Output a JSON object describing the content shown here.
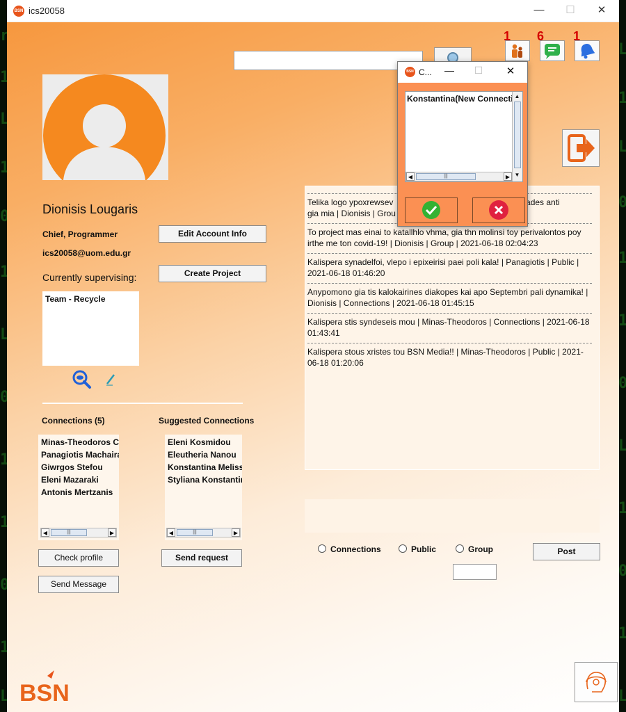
{
  "window": {
    "title": "ics20058",
    "logo_text": "BSN",
    "minimize": "—",
    "maximize": "☐",
    "close": "✕"
  },
  "search": {
    "value": "",
    "button_label": ""
  },
  "notifications": [
    {
      "icon": "connections-icon",
      "count": "1"
    },
    {
      "icon": "chat-icon",
      "count": "6"
    },
    {
      "icon": "bell-icon",
      "count": "1"
    }
  ],
  "profile": {
    "name": "Dionisis Lougaris",
    "role": "Chief, Programmer",
    "email": "ics20058@uom.edu.gr",
    "supervising_label": "Currently supervising:",
    "supervising_items": [
      "Team - Recycle"
    ]
  },
  "buttons": {
    "edit_account": "Edit Account Info",
    "create_project": "Create Project",
    "check_profile": "Check profile",
    "send_request": "Send request",
    "send_message": "Send Message",
    "post": "Post"
  },
  "connections": {
    "label": "Connections (5)",
    "items": [
      "Minas-Theodoros C",
      "Panagiotis Machaira",
      "Giwrgos Stefou",
      "Eleni Mazaraki",
      "Antonis Mertzanis"
    ]
  },
  "suggested": {
    "label": "Suggested Connections",
    "items": [
      "Eleni Kosmidou",
      "Eleutheria Nanou",
      "Konstantina Meliss",
      "Styliana Konstantin"
    ]
  },
  "feed": [
    "Telika logo ypoxrewsewn ... yo bdomades anti gia mia | Dionisis | Grou",
    "To project mas einai to katallhlo vhma, gia thn molinsi toy perivalontos poy irthe me ton covid-19! | Dionisis | Group | 2021-06-18 02:04:23",
    "Kalispera synadelfoi, vlepo i epixeirisi paei poli kala! | Panagiotis | Public | 2021-06-18 01:46:20",
    "Anypomono gia tis kalokairines diakopes kai apo Septembri pali dynamika! | Dionisis | Connections | 2021-06-18 01:45:15",
    "Kalispera stis syndeseis mou | Minas-Theodoros | Connections | 2021-06-18 01:43:41",
    "Kalispera stous xristes tou BSN Media!! | Minas-Theodoros | Public | 2021-06-18 01:20:06"
  ],
  "feed_first_visible": {
    "left": "Telika logo ypoxrewsev",
    "right": "yo bdomades anti",
    "line2": "gia mia | Dionisis | Grou"
  },
  "post_visibility": [
    "Connections",
    "Public",
    "Group"
  ],
  "popup": {
    "title": "C...",
    "items": [
      "Konstantina(New Connectio"
    ]
  },
  "brand_logo": "BSN",
  "colors": {
    "accent": "#f5891f",
    "accept": "#33b233",
    "reject": "#e0213f",
    "badge": "#d40000"
  }
}
